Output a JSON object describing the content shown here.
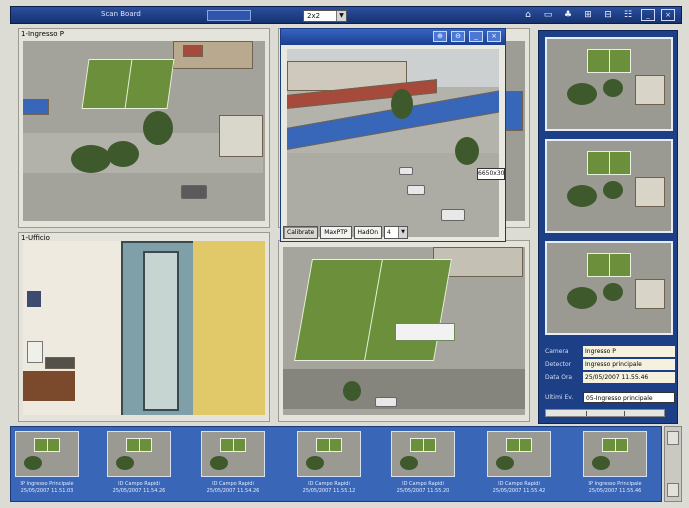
{
  "toolbar": {
    "app_title": "Scan Board",
    "layout_select_value": "2x2",
    "icons": [
      "camera-icon",
      "monitor-icon",
      "users-icon",
      "grid-icon",
      "sequence-icon",
      "settings-icon",
      "minimize-icon",
      "close-icon"
    ]
  },
  "tiles": [
    {
      "label": "1-Ingresso P"
    },
    {
      "label": ""
    },
    {
      "label": "1-Ufficio"
    },
    {
      "label": ""
    }
  ],
  "popup": {
    "ptz_tag": "6650x30",
    "buttons": [
      "Calibrate",
      "MaxPTP",
      "HadOn"
    ],
    "step_value": "4"
  },
  "info": {
    "camera_label": "Camera",
    "camera_value": "Ingresso P",
    "device_label": "Detector",
    "device_value": "Ingresso principale",
    "date_label": "Data Ora",
    "date_value": "25/05/2007 11.55.46",
    "last_label": "Ultimi Ev.",
    "last_value": "05-Ingresso principale"
  },
  "strip": [
    {
      "cap1": "IP Ingresso Principale",
      "cap2": "25/05/2007 11.51.03"
    },
    {
      "cap1": "ID Campo Rapidi",
      "cap2": "25/05/2007 11.54.26"
    },
    {
      "cap1": "ID Campo Rapidi",
      "cap2": "25/05/2007 11.54.26"
    },
    {
      "cap1": "ID Campo Rapidi",
      "cap2": "25/05/2007 11.55.12"
    },
    {
      "cap1": "ID Campo Rapidi",
      "cap2": "25/05/2007 11.55.20"
    },
    {
      "cap1": "ID Campo Rapidi",
      "cap2": "25/05/2007 11.55.42"
    },
    {
      "cap1": "IP Ingresso Principale",
      "cap2": "25/05/2007 11.55.46"
    }
  ]
}
